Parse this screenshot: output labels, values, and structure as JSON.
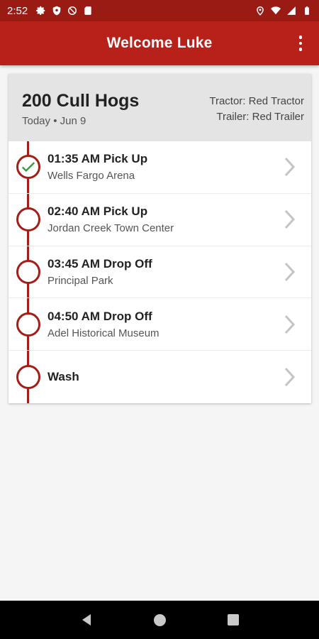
{
  "status_bar": {
    "time": "2:52",
    "left_icons": [
      "gear-icon",
      "shield-icon",
      "no-sync-icon",
      "sd-card-icon"
    ],
    "right_icons": [
      "location-icon",
      "wifi-icon",
      "signal-icon",
      "battery-icon"
    ]
  },
  "app_bar": {
    "title": "Welcome Luke",
    "menu_icon": "more-vert-icon"
  },
  "trip": {
    "title": "200 Cull Hogs",
    "date": "Today • Jun 9",
    "tractor": "Tractor: Red Tractor",
    "trailer": "Trailer: Red Trailer"
  },
  "stops": [
    {
      "title": "01:35 AM Pick Up",
      "location": "Wells Fargo Arena",
      "completed": true
    },
    {
      "title": "02:40 AM Pick Up",
      "location": "Jordan Creek Town Center",
      "completed": false
    },
    {
      "title": "03:45 AM Drop Off",
      "location": "Principal Park",
      "completed": false
    },
    {
      "title": "04:50 AM Drop Off",
      "location": "Adel Historical Museum",
      "completed": false
    },
    {
      "title": "Wash",
      "location": "",
      "completed": false
    }
  ],
  "colors": {
    "status_bar": "#9a1b14",
    "app_bar": "#b8201a",
    "timeline": "#a51d17",
    "check": "#2e9d3c",
    "chevron": "#c4c4c4"
  },
  "nav_bar": {
    "icons": [
      "back-icon",
      "home-icon",
      "recents-icon"
    ]
  }
}
